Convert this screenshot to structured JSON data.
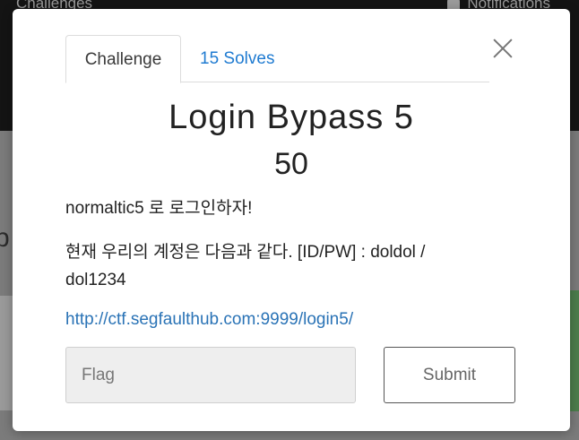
{
  "background": {
    "nav_title": "Challenges",
    "nav_right_label": "Notifications",
    "partial_letter": "p"
  },
  "modal": {
    "tabs": [
      {
        "label": "Challenge"
      },
      {
        "label": "15 Solves"
      }
    ],
    "title": "Login Bypass 5",
    "points": "50",
    "description_line1": "normaltic5 로 로그인하자!",
    "description_line2": "현재 우리의 계정은 다음과 같다. [ID/PW] : doldol / dol1234",
    "link_text": "http://ctf.segfaulthub.com:9999/login5/",
    "flag_placeholder": "Flag",
    "submit_label": "Submit"
  },
  "colors": {
    "link": "#2a73b6",
    "tab_link": "#1f7bd1",
    "nav_bg": "#141414"
  }
}
